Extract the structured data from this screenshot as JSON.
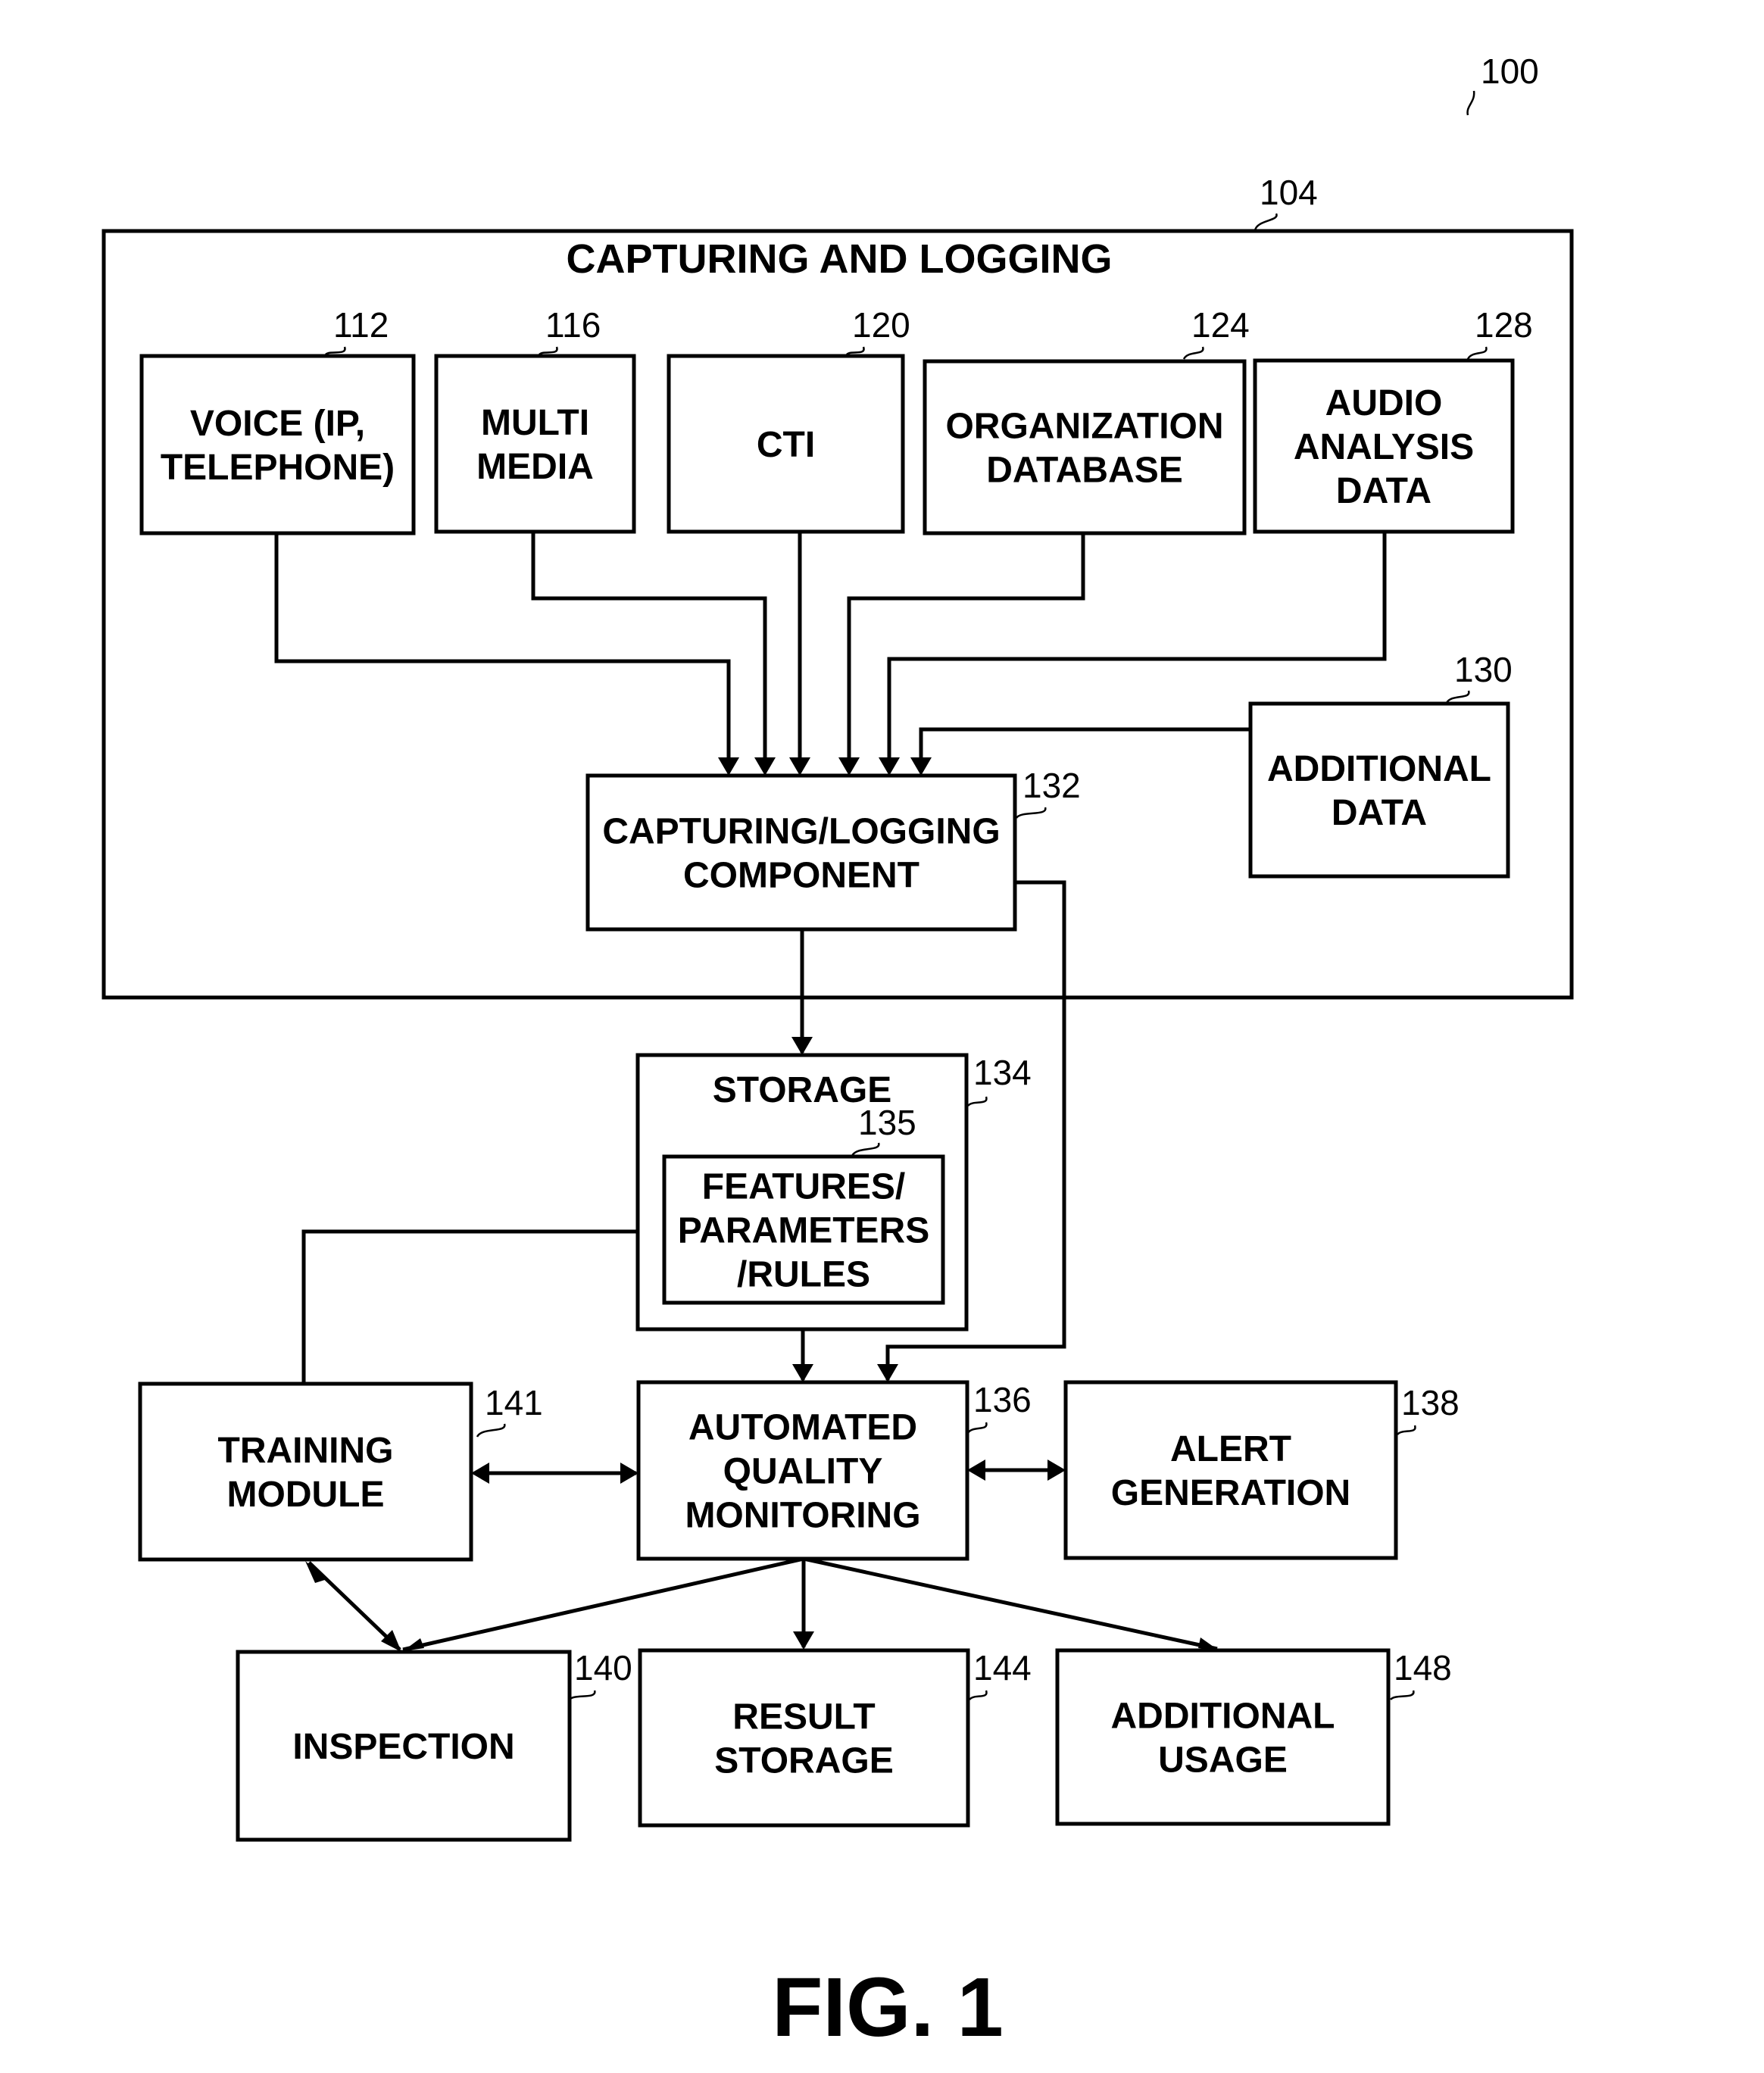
{
  "figure": {
    "ref": "100",
    "caption": "FIG. 1"
  },
  "container": {
    "ref": "104",
    "title": "CAPTURING AND LOGGING"
  },
  "blocks": {
    "voice": {
      "ref": "112",
      "lines": [
        "VOICE (IP,",
        "TELEPHONE)"
      ]
    },
    "multimedia": {
      "ref": "116",
      "lines": [
        "MULTI",
        "MEDIA"
      ]
    },
    "cti": {
      "ref": "120",
      "lines": [
        "CTI"
      ]
    },
    "org_db": {
      "ref": "124",
      "lines": [
        "ORGANIZATION",
        "DATABASE"
      ]
    },
    "audio_analysis": {
      "ref": "128",
      "lines": [
        "AUDIO",
        "ANALYSIS",
        "DATA"
      ]
    },
    "additional_data": {
      "ref": "130",
      "lines": [
        "ADDITIONAL",
        "DATA"
      ]
    },
    "capture_component": {
      "ref": "132",
      "lines": [
        "CAPTURING/LOGGING",
        "COMPONENT"
      ]
    },
    "storage": {
      "ref": "134",
      "lines": [
        "STORAGE"
      ]
    },
    "features": {
      "ref": "135",
      "lines": [
        "FEATURES/",
        "PARAMETERS",
        "/RULES"
      ]
    },
    "aqm": {
      "ref": "136",
      "lines": [
        "AUTOMATED",
        "QUALITY",
        "MONITORING"
      ]
    },
    "alert": {
      "ref": "138",
      "lines": [
        "ALERT",
        "GENERATION"
      ]
    },
    "training": {
      "ref": "141",
      "lines": [
        "TRAINING",
        "MODULE"
      ]
    },
    "inspection": {
      "ref": "140",
      "lines": [
        "INSPECTION"
      ]
    },
    "result_storage": {
      "ref": "144",
      "lines": [
        "RESULT",
        "STORAGE"
      ]
    },
    "additional_usage": {
      "ref": "148",
      "lines": [
        "ADDITIONAL",
        "USAGE"
      ]
    }
  },
  "connections": [
    {
      "from": "voice",
      "to": "capture_component",
      "direction": "forward"
    },
    {
      "from": "multimedia",
      "to": "capture_component",
      "direction": "forward"
    },
    {
      "from": "cti",
      "to": "capture_component",
      "direction": "forward"
    },
    {
      "from": "org_db",
      "to": "capture_component",
      "direction": "forward"
    },
    {
      "from": "audio_analysis",
      "to": "capture_component",
      "direction": "forward"
    },
    {
      "from": "additional_data",
      "to": "capture_component",
      "direction": "forward"
    },
    {
      "from": "capture_component",
      "to": "storage",
      "direction": "forward"
    },
    {
      "from": "capture_component",
      "to": "aqm",
      "direction": "forward"
    },
    {
      "from": "storage",
      "to": "aqm",
      "direction": "forward"
    },
    {
      "from": "training",
      "to": "features",
      "direction": "forward"
    },
    {
      "from": "training",
      "to": "aqm",
      "direction": "both"
    },
    {
      "from": "aqm",
      "to": "alert",
      "direction": "both"
    },
    {
      "from": "training",
      "to": "inspection",
      "direction": "both"
    },
    {
      "from": "aqm",
      "to": "inspection",
      "direction": "forward"
    },
    {
      "from": "aqm",
      "to": "result_storage",
      "direction": "forward"
    },
    {
      "from": "aqm",
      "to": "additional_usage",
      "direction": "forward"
    }
  ]
}
